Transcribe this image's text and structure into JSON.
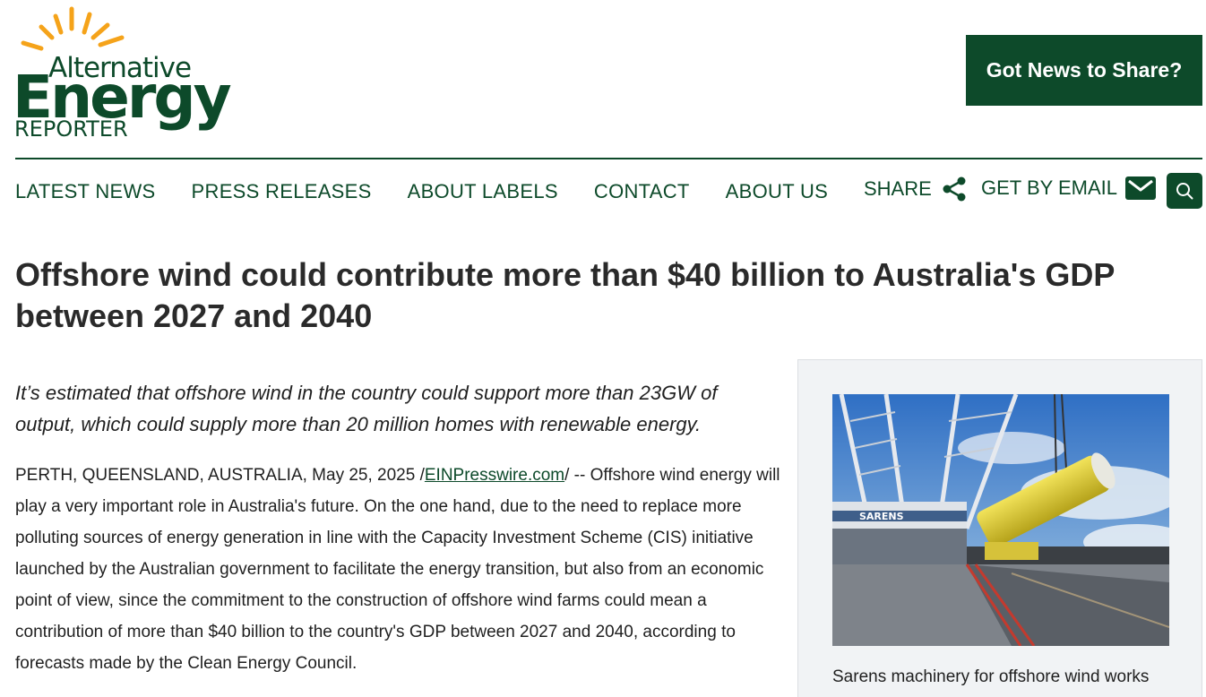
{
  "logo": {
    "line1": "Alternative",
    "line2": "Energy",
    "line3": "REPORTER"
  },
  "header": {
    "cta_label": "Got News to Share?"
  },
  "nav": {
    "items": [
      {
        "label": "LATEST NEWS"
      },
      {
        "label": "PRESS RELEASES"
      },
      {
        "label": "ABOUT LABELS"
      },
      {
        "label": "CONTACT"
      },
      {
        "label": "ABOUT US"
      }
    ],
    "share_label": "SHARE",
    "email_label": "GET BY EMAIL"
  },
  "article": {
    "title": "Offshore wind could contribute more than $40 billion to Australia's GDP between 2027 and 2040",
    "lede": "It’s estimated that offshore wind in the country could support more than 23GW of output, which could supply more than 20 million homes with renewable energy.",
    "dateline": "PERTH, QUEENSLAND, AUSTRALIA, May 25, 2025 /",
    "source_link": "EINPresswire.com",
    "body": "/ -- Offshore wind energy will play a very important role in Australia's future. On the one hand, due to the need to replace more polluting sources of energy generation in line with the Capacity Investment Scheme (CIS) initiative launched by the Australian government to facilitate the energy transition, but also from an economic point of view, since the commitment to the construction of offshore wind farms could mean a contribution of more than $40 billion to the country's GDP between 2027 and 2040, according to forecasts made by the Clean Energy Council."
  },
  "figure": {
    "caption": "Sarens machinery for offshore wind works",
    "crane_text": "SARENS"
  },
  "colors": {
    "brand_green": "#0d4a2a",
    "logo_orange": "#f5a31a"
  }
}
